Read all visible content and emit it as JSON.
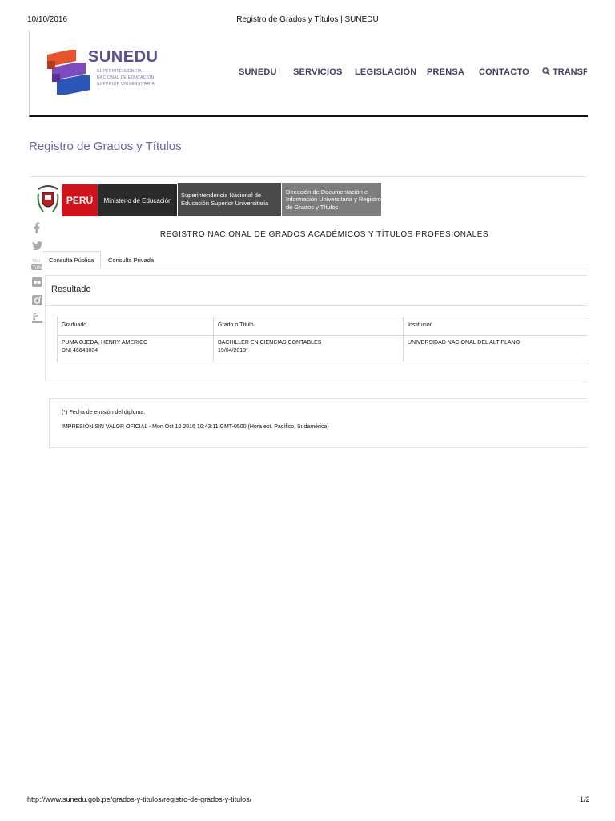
{
  "print": {
    "date": "10/10/2016",
    "title": "Registro de Grados y Títulos | SUNEDU",
    "url": "http://www.sunedu.gob.pe/grados-y-titulos/registro-de-grados-y-titulos/",
    "page": "1/2"
  },
  "header": {
    "logo_text": "SUNEDU",
    "logo_sub": [
      "SUPERINTENDENCIA",
      "NACIONAL DE EDUCACIÓN",
      "SUPERIOR UNIVERSITARIA"
    ],
    "nav": [
      "SUNEDU",
      "SERVICIOS",
      "LEGISLACIÓN",
      "PRENSA",
      "CONTACTO"
    ],
    "search_label": "TRANSP"
  },
  "page_title": "Registro de Grados y Títulos",
  "banner": {
    "peru": "PERÚ",
    "ministerio": "Ministerio de Educación",
    "superintendencia": "Superintendencia Nacional de Educación Superior Universitaria",
    "direccion": "Dirección de Documentación e Información Universitaria y Registro de Grados y Títulos"
  },
  "registry_title": "REGISTRO NACIONAL DE GRADOS ACADÉMICOS Y TÍTULOS PROFESIONALES",
  "social_icons": [
    "facebook-icon",
    "twitter-icon",
    "youtube-icon",
    "flickr-icon",
    "instagram-icon",
    "rss-icon"
  ],
  "tabs": [
    "Consulta Pública",
    "Consulta Privada"
  ],
  "result": {
    "heading": "Resultado",
    "columns": [
      "Graduado",
      "Grado o Título",
      "Institución"
    ],
    "rows": [
      {
        "graduado": "PUMA OJEDA, HENRY AMERICO",
        "dni": "DNI 46643034",
        "grado": "BACHILLER EN CIENCIAS CONTABLES",
        "fecha": "19/04/2013*",
        "institucion": "UNIVERSIDAD NACIONAL DEL ALTIPLANO"
      }
    ]
  },
  "notes": {
    "note1": "(*) Fecha de emisión del diploma.",
    "note2": "IMPRESIÓN SIN VALOR OFICIAL - Mon Oct 10 2016 10:43:11 GMT-0500 (Hora est. Pacífico, Sudamérica)"
  }
}
